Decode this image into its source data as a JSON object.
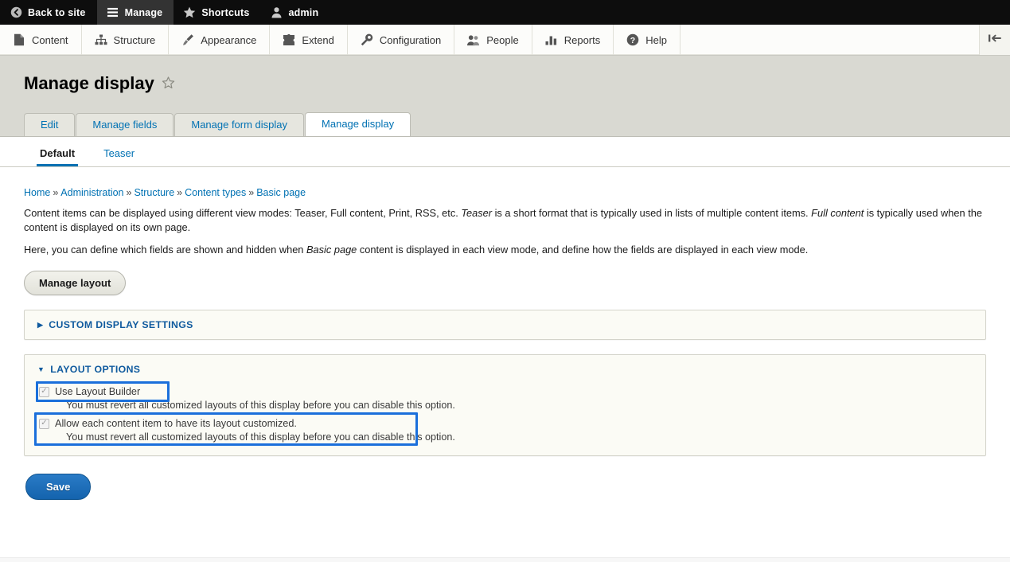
{
  "toolbar": {
    "items": [
      {
        "label": "Back to site",
        "icon": "back-arrow-icon",
        "active": false
      },
      {
        "label": "Manage",
        "icon": "hamburger-icon",
        "active": true
      },
      {
        "label": "Shortcuts",
        "icon": "star-icon",
        "active": false
      },
      {
        "label": "admin",
        "icon": "user-icon",
        "active": false
      }
    ]
  },
  "admin_menu": {
    "items": [
      {
        "label": "Content",
        "icon": "document-icon"
      },
      {
        "label": "Structure",
        "icon": "sitemap-icon"
      },
      {
        "label": "Appearance",
        "icon": "paintbrush-icon"
      },
      {
        "label": "Extend",
        "icon": "puzzle-icon"
      },
      {
        "label": "Configuration",
        "icon": "wrench-icon"
      },
      {
        "label": "People",
        "icon": "people-icon"
      },
      {
        "label": "Reports",
        "icon": "bar-chart-icon"
      },
      {
        "label": "Help",
        "icon": "question-mark-icon"
      }
    ],
    "orientation_toggle_icon": "toolbar-orientation-icon"
  },
  "page": {
    "title": "Manage display",
    "favorite_icon": "star-outline-icon"
  },
  "primary_tabs": [
    {
      "label": "Edit",
      "active": false
    },
    {
      "label": "Manage fields",
      "active": false
    },
    {
      "label": "Manage form display",
      "active": false
    },
    {
      "label": "Manage display",
      "active": true
    }
  ],
  "secondary_tabs": [
    {
      "label": "Default",
      "active": true
    },
    {
      "label": "Teaser",
      "active": false
    }
  ],
  "breadcrumb": {
    "separator": "»",
    "items": [
      "Home",
      "Administration",
      "Structure",
      "Content types",
      "Basic page"
    ]
  },
  "intro": {
    "p1_a": "Content items can be displayed using different view modes: Teaser, Full content, Print, RSS, etc. ",
    "p1_em1": "Teaser",
    "p1_b": " is a short format that is typically used in lists of multiple content items. ",
    "p1_em2": "Full content",
    "p1_c": " is typically used when the content is displayed on its own page.",
    "p2_a": "Here, you can define which fields are shown and hidden when ",
    "p2_em1": "Basic page",
    "p2_b": " content is displayed in each view mode, and define how the fields are displayed in each view mode."
  },
  "manage_layout_button": {
    "label": "Manage layout"
  },
  "custom_display_settings": {
    "summary": "CUSTOM DISPLAY SETTINGS",
    "expanded": false,
    "marker": "▶"
  },
  "layout_options": {
    "summary": "LAYOUT OPTIONS",
    "expanded": true,
    "marker": "▼",
    "checkboxes": [
      {
        "label": "Use Layout Builder",
        "checked": true,
        "check_glyph": "✓",
        "description": "You must revert all customized layouts of this display before you can disable this option.",
        "highlighted": true
      },
      {
        "label": "Allow each content item to have its layout customized.",
        "checked": true,
        "check_glyph": "✓",
        "description": "You must revert all customized layouts of this display before you can disable this option.",
        "highlighted": true
      }
    ]
  },
  "save_button": {
    "label": "Save"
  },
  "colors": {
    "toolbar_bg": "#0d0d0d",
    "toolbar_active": "#333333",
    "tray_bg": "#fcfcfa",
    "header_bg": "#d9d9d2",
    "link_blue": "#0071b3",
    "details_blue": "#0f5a9e",
    "highlight_blue": "#1a6fdb",
    "save_blue": "#1463ad",
    "details_bg": "#fbfbf5"
  }
}
